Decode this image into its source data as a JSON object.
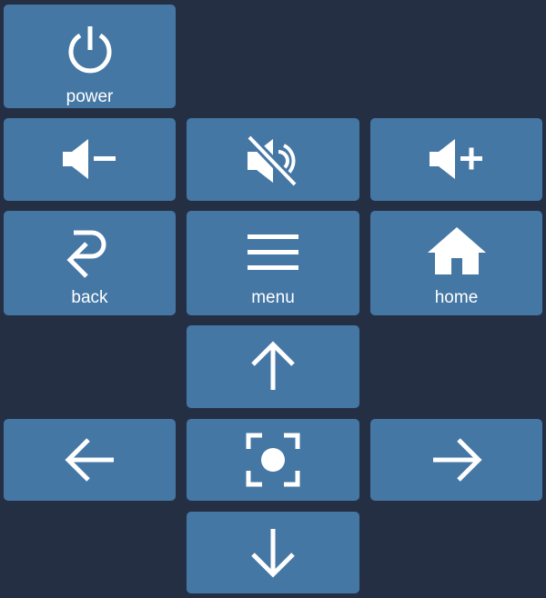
{
  "colors": {
    "background": "#252f44",
    "button": "#4577a5",
    "foreground": "#ffffff"
  },
  "buttons": {
    "power": {
      "label": "power",
      "icon": "power-icon"
    },
    "volume_down": {
      "icon": "volume-down-icon"
    },
    "mute": {
      "icon": "mute-icon"
    },
    "volume_up": {
      "icon": "volume-up-icon"
    },
    "back": {
      "label": "back",
      "icon": "back-icon"
    },
    "menu": {
      "label": "menu",
      "icon": "menu-icon"
    },
    "home": {
      "label": "home",
      "icon": "home-icon"
    },
    "up": {
      "icon": "arrow-up-icon"
    },
    "left": {
      "icon": "arrow-left-icon"
    },
    "ok": {
      "icon": "select-center-icon"
    },
    "right": {
      "icon": "arrow-right-icon"
    },
    "down": {
      "icon": "arrow-down-icon"
    }
  }
}
